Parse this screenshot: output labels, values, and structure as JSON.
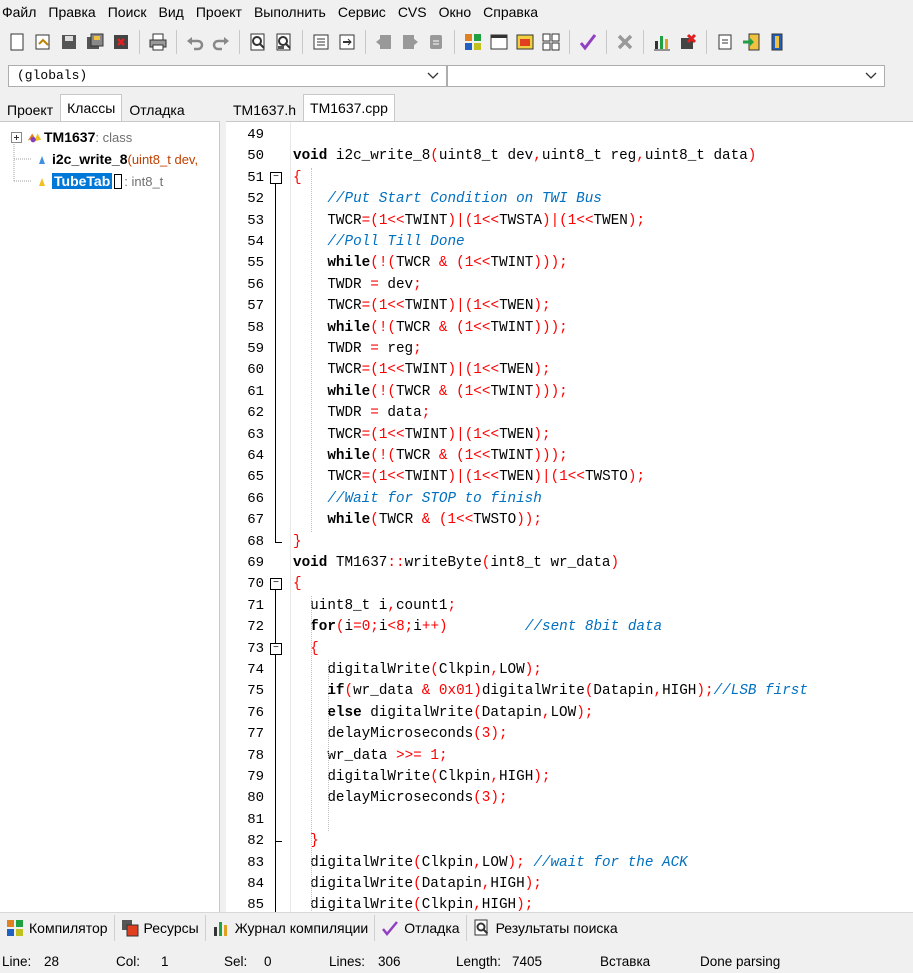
{
  "menu": [
    "Файл",
    "Правка",
    "Поиск",
    "Вид",
    "Проект",
    "Выполнить",
    "Сервис",
    "CVS",
    "Окно",
    "Справка"
  ],
  "toolbar": {
    "groups": [
      [
        "new-file-icon",
        "open-file-icon",
        "save-icon",
        "save-all-icon",
        "close-file-icon"
      ],
      [
        "print-icon"
      ],
      [
        "undo-icon",
        "redo-icon"
      ],
      [
        "find-icon",
        "replace-icon"
      ],
      [
        "indent-icon",
        "unindent-icon"
      ],
      [
        "bookmark-prev-icon",
        "bookmark-next-icon",
        "toggle-bookmark-icon"
      ],
      [
        "compile-icon",
        "run-icon",
        "compile-run-icon",
        "rebuild-icon"
      ],
      [
        "check-icon"
      ],
      [
        "stop-icon"
      ],
      [
        "profile-icon",
        "debug-icon"
      ],
      [
        "new-class-icon",
        "goto-icon",
        "exit-icon"
      ]
    ]
  },
  "scope": {
    "left_value": "(globals)",
    "right_value": ""
  },
  "left_panel": {
    "tabs": [
      "Проект",
      "Классы",
      "Отладка"
    ],
    "active_tab": 1,
    "tree": [
      {
        "name": "TM1637",
        "meta": " : class"
      },
      {
        "name": "i2c_write_8",
        "meta": "(uint8_t dev,"
      },
      {
        "name": "TubeTab",
        "meta": " : int8_t"
      }
    ]
  },
  "editor": {
    "tabs": [
      "TM1637.h",
      "TM1637.cpp"
    ],
    "active_tab": 1,
    "lines": [
      {
        "n": "49",
        "code": ""
      },
      {
        "n": "50",
        "code": "void i2c_write_8(uint8_t dev,uint8_t reg,uint8_t data)"
      },
      {
        "n": "51",
        "code": "{"
      },
      {
        "n": "52",
        "code": "    //Put Start Condition on TWI Bus"
      },
      {
        "n": "53",
        "code": "    TWCR=(1<<TWINT)|(1<<TWSTA)|(1<<TWEN);"
      },
      {
        "n": "54",
        "code": "    //Poll Till Done"
      },
      {
        "n": "55",
        "code": "    while(!(TWCR & (1<<TWINT)));"
      },
      {
        "n": "56",
        "code": "    TWDR = dev;"
      },
      {
        "n": "57",
        "code": "    TWCR=(1<<TWINT)|(1<<TWEN);"
      },
      {
        "n": "58",
        "code": "    while(!(TWCR & (1<<TWINT)));"
      },
      {
        "n": "59",
        "code": "    TWDR = reg;"
      },
      {
        "n": "60",
        "code": "    TWCR=(1<<TWINT)|(1<<TWEN);"
      },
      {
        "n": "61",
        "code": "    while(!(TWCR & (1<<TWINT)));"
      },
      {
        "n": "62",
        "code": "    TWDR = data;"
      },
      {
        "n": "63",
        "code": "    TWCR=(1<<TWINT)|(1<<TWEN);"
      },
      {
        "n": "64",
        "code": "    while(!(TWCR & (1<<TWINT)));"
      },
      {
        "n": "65",
        "code": "    TWCR=(1<<TWINT)|(1<<TWEN)|(1<<TWSTO);"
      },
      {
        "n": "66",
        "code": "    //Wait for STOP to finish"
      },
      {
        "n": "67",
        "code": "    while(TWCR & (1<<TWSTO));"
      },
      {
        "n": "68",
        "code": "}"
      },
      {
        "n": "69",
        "code": "void TM1637::writeByte(int8_t wr_data)"
      },
      {
        "n": "70",
        "code": "{"
      },
      {
        "n": "71",
        "code": "  uint8_t i,count1;"
      },
      {
        "n": "72",
        "code": "  for(i=0;i<8;i++)         //sent 8bit data"
      },
      {
        "n": "73",
        "code": "  {"
      },
      {
        "n": "74",
        "code": "    digitalWrite(Clkpin,LOW);"
      },
      {
        "n": "75",
        "code": "    if(wr_data & 0x01)digitalWrite(Datapin,HIGH);//LSB first"
      },
      {
        "n": "76",
        "code": "    else digitalWrite(Datapin,LOW);"
      },
      {
        "n": "77",
        "code": "    delayMicroseconds(3);"
      },
      {
        "n": "78",
        "code": "    wr_data >>= 1;"
      },
      {
        "n": "79",
        "code": "    digitalWrite(Clkpin,HIGH);"
      },
      {
        "n": "80",
        "code": "    delayMicroseconds(3);"
      },
      {
        "n": "81",
        "code": ""
      },
      {
        "n": "82",
        "code": "  }"
      },
      {
        "n": "83",
        "code": "  digitalWrite(Clkpin,LOW); //wait for the ACK"
      },
      {
        "n": "84",
        "code": "  digitalWrite(Datapin,HIGH);"
      },
      {
        "n": "85",
        "code": "  digitalWrite(Clkpin,HIGH);"
      }
    ]
  },
  "bottom_tabs": [
    {
      "icon": "compiler-icon",
      "label": "Компилятор"
    },
    {
      "icon": "resources-icon",
      "label": "Ресурсы"
    },
    {
      "icon": "compile-log-icon",
      "label": "Журнал компиляции"
    },
    {
      "icon": "debug-check-icon",
      "label": "Отладка"
    },
    {
      "icon": "search-results-icon",
      "label": "Результаты поиска"
    }
  ],
  "status": {
    "line_label": "Line:",
    "line": "28",
    "col_label": "Col:",
    "col": "1",
    "sel_label": "Sel:",
    "sel": "0",
    "lines_label": "Lines:",
    "lines": "306",
    "length_label": "Length:",
    "length": "7405",
    "mode": "Вставка",
    "message": "Done parsing"
  },
  "colors": {
    "keyword": "#000000",
    "symbol": "#ff0000",
    "comment": "#0070c0",
    "selection": "#0078d7"
  }
}
